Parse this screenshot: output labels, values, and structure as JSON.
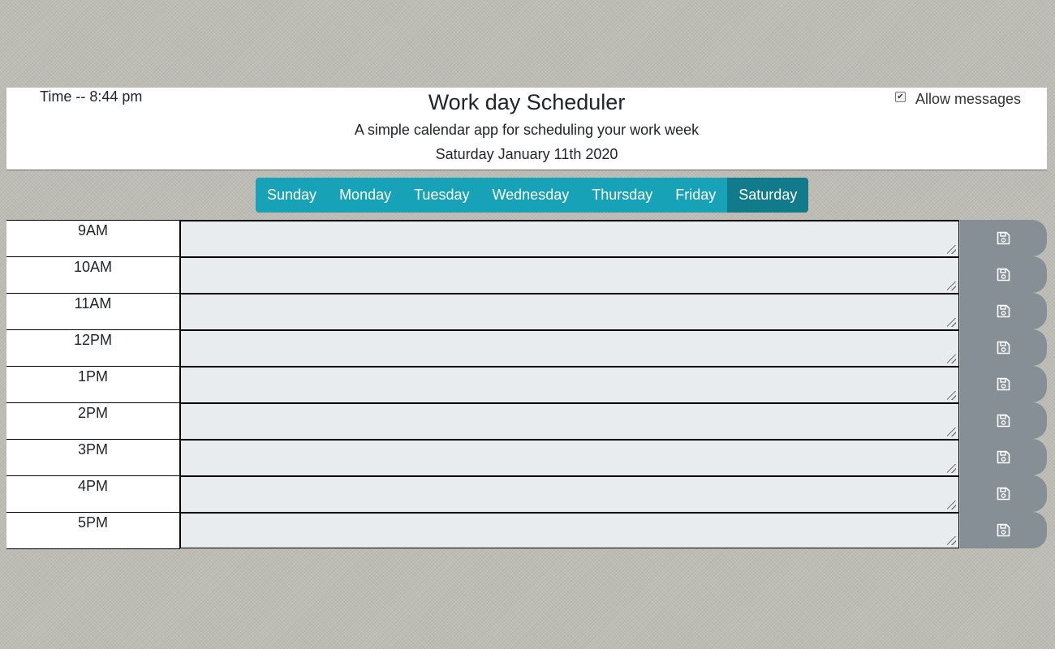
{
  "header": {
    "time_text": "Time -- 8:44 pm",
    "title": "Work day Scheduler",
    "subtitle": "A simple calendar app for scheduling your work week",
    "date": "Saturday January 11th 2020",
    "allow_messages_label": "Allow messages",
    "allow_messages_checked": true
  },
  "days": [
    {
      "label": "Sunday",
      "active": false
    },
    {
      "label": "Monday",
      "active": false
    },
    {
      "label": "Tuesday",
      "active": false
    },
    {
      "label": "Wednesday",
      "active": false
    },
    {
      "label": "Thursday",
      "active": false
    },
    {
      "label": "Friday",
      "active": false
    },
    {
      "label": "Saturday",
      "active": true
    }
  ],
  "hours": [
    {
      "label": "9AM",
      "text": ""
    },
    {
      "label": "10AM",
      "text": ""
    },
    {
      "label": "11AM",
      "text": ""
    },
    {
      "label": "12PM",
      "text": ""
    },
    {
      "label": "1PM",
      "text": ""
    },
    {
      "label": "2PM",
      "text": ""
    },
    {
      "label": "3PM",
      "text": ""
    },
    {
      "label": "4PM",
      "text": ""
    },
    {
      "label": "5PM",
      "text": ""
    }
  ],
  "icons": {
    "save": "save-icon",
    "checkbox": "checkbox-checked-icon"
  },
  "colors": {
    "day_button": "#17a2b8",
    "day_button_active": "#117a8b",
    "save_button": "#868e96",
    "task_area": "#e9ecef"
  }
}
